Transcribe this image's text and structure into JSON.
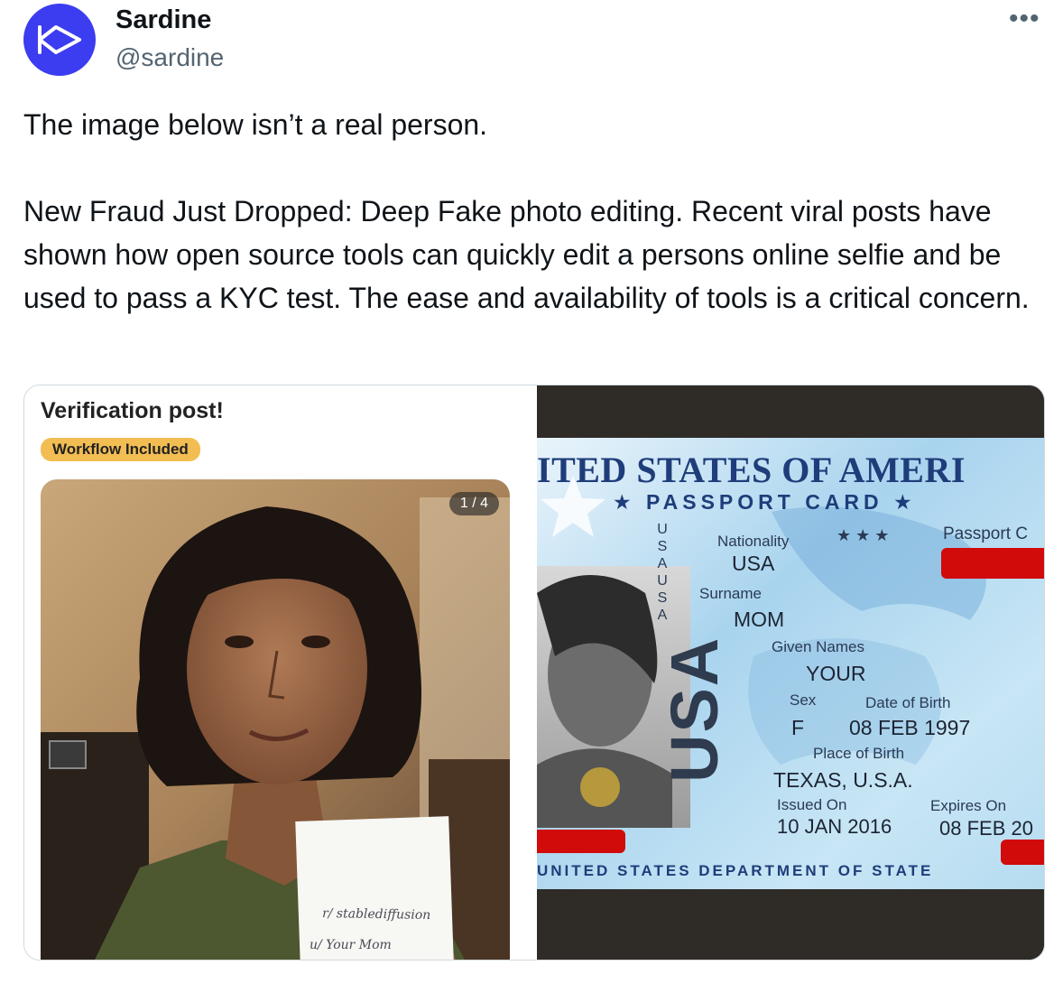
{
  "account": {
    "name": "Sardine",
    "handle": "@sardine",
    "avatar_icon": "sardine-logo-icon",
    "avatar_color": "#3c3cf0"
  },
  "more_label": "•••",
  "tweet_text": "The image below isn’t a real person.\n\nNew Fraud Just Dropped: Deep Fake photo editing. Recent viral posts have shown how open source tools can quickly edit a persons online selfie and be used to pass a KYC test. The ease and availability of tools is a critical concern.",
  "left_image": {
    "title": "Verification post!",
    "flair": "Workflow Included",
    "flair_color": "#f2bd52",
    "page_indicator": "1 / 4",
    "note_line1": "r/ stablediffusion",
    "note_line2": "u/ Your Mom"
  },
  "passport_card": {
    "header": "ITED STATES OF AMERI",
    "subheader": "★ PASSPORT CARD ★",
    "vertical_text": "USAUSA",
    "big_text": "USA",
    "stars": "★ ★ ★",
    "card_no_label": "Passport C",
    "nationality_label": "Nationality",
    "nationality": "USA",
    "surname_label": "Surname",
    "surname": "MOM",
    "given_names_label": "Given Names",
    "given_names": "YOUR",
    "sex_label": "Sex",
    "sex": "F",
    "dob_label": "Date of Birth",
    "dob": "08 FEB 1997",
    "pob_label": "Place of Birth",
    "pob": "TEXAS, U.S.A.",
    "issued_label": "Issued On",
    "issued": "10 JAN 2016",
    "expires_label": "Expires On",
    "expires": "08 FEB 20",
    "footer": "UNITED STATES DEPARTMENT OF STATE",
    "redaction_color": "#d10a0a"
  }
}
